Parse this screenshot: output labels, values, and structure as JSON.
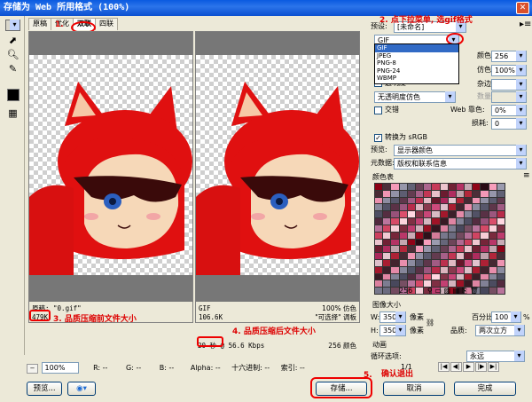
{
  "window": {
    "title": "存储为 Web 所用格式 (100%)"
  },
  "tabs": [
    "原稿",
    "优化",
    "双联",
    "四联"
  ],
  "left_pane": {
    "line1": "原稿: \"0.gif\"",
    "line2": "479K",
    "annotation": "3. 品质压缩前文件大小"
  },
  "right_pane": {
    "format": "GIF",
    "size": "106.6K",
    "speed": "20 秒 @ 56.6 Kbps",
    "pct": "100% 仿色",
    "pal": "\"可选择\" 调板",
    "colors": "256 颜色",
    "annotation": "4. 品质压缩后文件大小"
  },
  "annotations": {
    "step1": "1.",
    "step2": "2. 点下拉菜单, 选gif格式",
    "step5": "5.",
    "step5_text": "确认退出"
  },
  "statusbar": {
    "zoom": "100%",
    "r_label": "R:",
    "r_value": "--",
    "g_label": "G:",
    "g_value": "--",
    "b_label": "B:",
    "b_value": "--",
    "alpha": "Alpha: --",
    "hex": "十六进制: --",
    "index": "索引: --"
  },
  "bottom": {
    "preview_label": "预览...",
    "save": "存储...",
    "cancel": "取消",
    "done": "完成",
    "page_indicator": "1/1"
  },
  "settings": {
    "preset_label": "预设:",
    "preset_value": "[未命名]",
    "format_value": "GIF",
    "format_options": [
      "GIF",
      "JPEG",
      "PNG-8",
      "PNG-24",
      "WBMP"
    ],
    "colors_label": "颜色:",
    "colors_value": "256",
    "dither_label": "仿色:",
    "dither_value": "100%",
    "matte_label": "杂边:",
    "transparency_label": "透明度",
    "no_transparency_dither": "无透明度仿色",
    "amount_label": "数量:",
    "interlaced_label": "交错",
    "websnap_label": "Web 靠色:",
    "websnap_value": "0%",
    "lossy_label": "损耗:",
    "lossy_value": "0",
    "srgb_label": "转换为 sRGB",
    "preview_label": "预览:",
    "preview_value": "显示器颜色",
    "metadata_label": "元数据:",
    "metadata_value": "版权和联系信息",
    "color_table_label": "颜色表",
    "color_count": "256",
    "image_size_label": "图像大小",
    "w_label": "W:",
    "w_value": "350",
    "h_label": "H:",
    "h_value": "350",
    "unit": "像素",
    "percent_label": "百分比:",
    "percent_value": "100",
    "percent_unit": "%",
    "quality_label": "品质:",
    "quality_value": "两次立方",
    "animation_label": "动画",
    "loop_label": "循环选项:",
    "loop_value": "永远"
  },
  "colors": {
    "titlebar": "#0a5ae0",
    "annotation": "#dd0000",
    "dialog_bg": "#ece9d8"
  }
}
